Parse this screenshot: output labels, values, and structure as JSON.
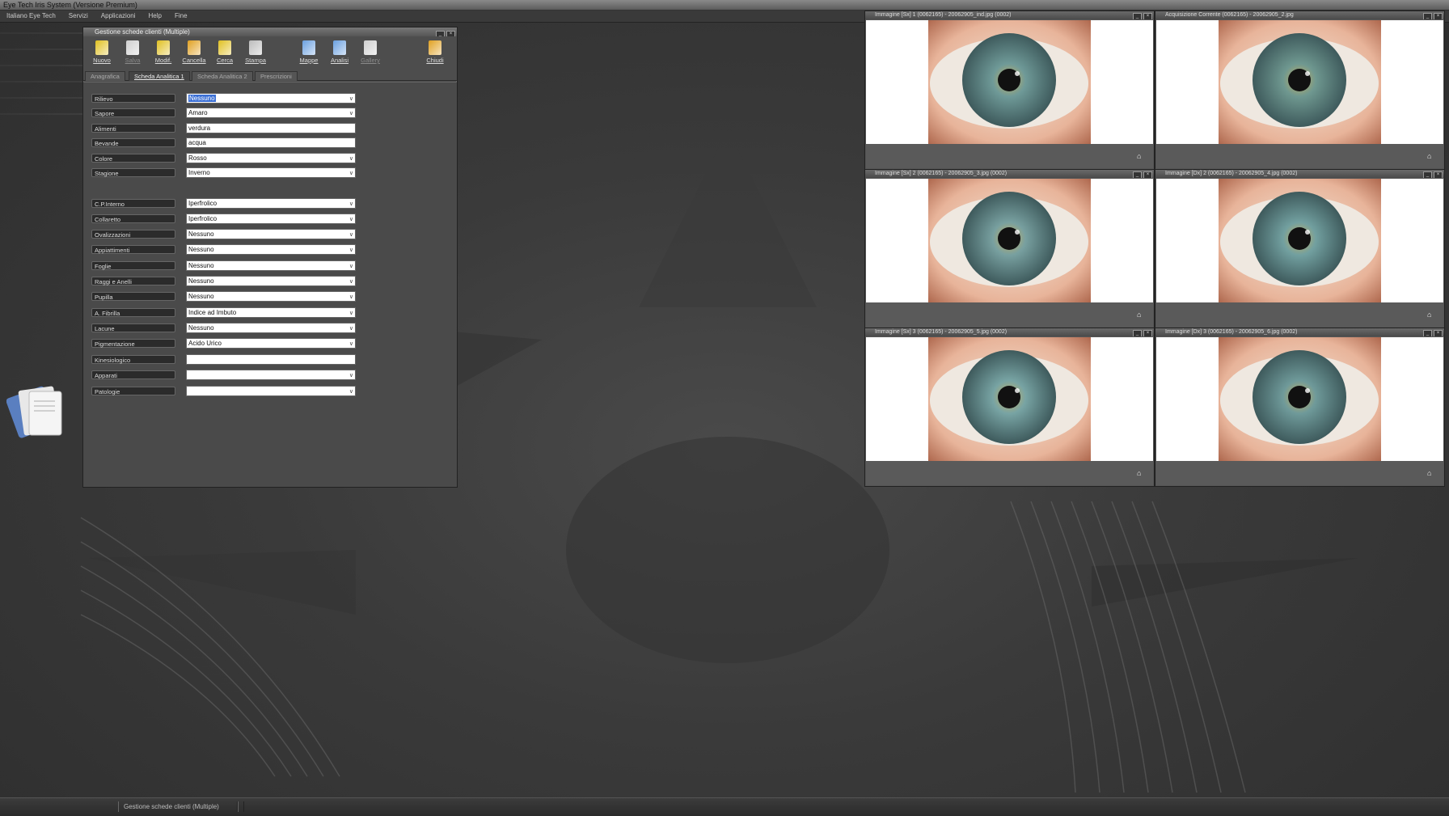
{
  "app": {
    "title": "Eye Tech Iris System (Versione Premium)"
  },
  "menu": [
    "Italiano Eye Tech",
    "Servizi",
    "Applicazioni",
    "Help",
    "Fine"
  ],
  "status": {
    "message": "Gestione schede clienti (Multiple)"
  },
  "form_window": {
    "title": "Gestione schede clienti (Multiple)",
    "toolbar": [
      {
        "label": "Nuovo",
        "icon": "new-doc-icon",
        "color": "#e0c020",
        "enabled": true
      },
      {
        "label": "Salva",
        "icon": "save-icon",
        "color": "#cfcfcf",
        "enabled": false
      },
      {
        "label": "Modif.",
        "icon": "edit-icon",
        "color": "#e0c020",
        "enabled": true
      },
      {
        "label": "Cancella",
        "icon": "delete-icon",
        "color": "#e0a020",
        "enabled": true
      },
      {
        "label": "Cerca",
        "icon": "search-icon",
        "color": "#e0c020",
        "enabled": true
      },
      {
        "label": "Stampa",
        "icon": "print-icon",
        "color": "#bcbcbc",
        "enabled": true
      },
      {
        "label": "Mappe",
        "icon": "map-icon",
        "color": "#6aa0e0",
        "enabled": true
      },
      {
        "label": "Analisi",
        "icon": "analysis-icon",
        "color": "#6aa0e0",
        "enabled": true
      },
      {
        "label": "Gallery",
        "icon": "gallery-icon",
        "color": "#cfcfcf",
        "enabled": false
      },
      {
        "label": "Chiudi",
        "icon": "close-door-icon",
        "color": "#e0a020",
        "enabled": true
      }
    ],
    "tabs": [
      {
        "label": "Anagrafica",
        "active": false
      },
      {
        "label": "Scheda Analitica 1",
        "active": true
      },
      {
        "label": "Scheda Analitica 2",
        "active": false
      },
      {
        "label": "Prescrizioni",
        "active": false
      }
    ],
    "fields": [
      {
        "label": "Rilievo",
        "value": "Nessuno",
        "dropdown": true,
        "selected": true
      },
      {
        "label": "Sapore",
        "value": "Amaro",
        "dropdown": true
      },
      {
        "label": "Alimenti",
        "value": "verdura",
        "dropdown": false
      },
      {
        "label": "Bevande",
        "value": "acqua",
        "dropdown": false
      },
      {
        "label": "Colore",
        "value": "Rosso",
        "dropdown": true
      },
      {
        "label": "Stagione",
        "value": "Inverno",
        "dropdown": true
      },
      {
        "label": "C.P.Interno",
        "value": "Iperfrolico",
        "dropdown": true
      },
      {
        "label": "Collaretto",
        "value": "Iperfrolico",
        "dropdown": true
      },
      {
        "label": "Ovalizzazioni",
        "value": "Nessuno",
        "dropdown": true
      },
      {
        "label": "Appiattimenti",
        "value": "Nessuno",
        "dropdown": true
      },
      {
        "label": "Foglie",
        "value": "Nessuno",
        "dropdown": true
      },
      {
        "label": "Raggi e Anelli",
        "value": "Nessuno",
        "dropdown": true
      },
      {
        "label": "Pupilla",
        "value": "Nessuno",
        "dropdown": true
      },
      {
        "label": "A. Fibrilla",
        "value": "Indice ad Imbuto",
        "dropdown": true
      },
      {
        "label": "Lacune",
        "value": "Nessuno",
        "dropdown": true
      },
      {
        "label": "Pigmentazione",
        "value": "Acido Urico",
        "dropdown": true
      },
      {
        "label": "Kinesiologico",
        "value": "",
        "dropdown": false
      },
      {
        "label": "Apparati",
        "value": "",
        "dropdown": true
      },
      {
        "label": "Patologie",
        "value": "",
        "dropdown": true
      }
    ]
  },
  "image_windows": [
    {
      "title": "Immagine [Sx] 1 (0062165) - 20062905_ind.jpg (0002)",
      "iris": "#6f9a98"
    },
    {
      "title": "Acquisizione Corrente (0062165) - 20062905_2.jpg",
      "iris": "#6f9890"
    },
    {
      "title": "Immagine [Sx] 2 (0062165) - 20062905_3.jpg (0002)",
      "iris": "#78a0a0"
    },
    {
      "title": "Immagine [Dx] 2 (0062165) - 20062905_4.jpg (0002)",
      "iris": "#72a0a0"
    },
    {
      "title": "Immagine [Sx] 3 (0062165) - 20062905_5.jpg (0002)",
      "iris": "#78a4a4"
    },
    {
      "title": "Immagine [Dx] 3 (0062165) - 20062905_6.jpg (0002)",
      "iris": "#6f9a9a"
    }
  ]
}
